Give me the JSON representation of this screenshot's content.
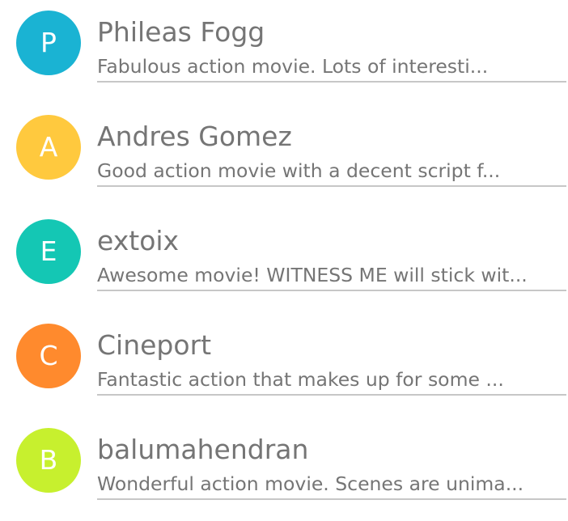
{
  "reviews": [
    {
      "initial": "P",
      "name": "Phileas Fogg",
      "snippet": "Fabulous action movie. Lots of interesti...",
      "color": "#1ab3d3"
    },
    {
      "initial": "A",
      "name": "Andres Gomez",
      "snippet": "Good action movie with a decent script f...",
      "color": "#ffc93e"
    },
    {
      "initial": "E",
      "name": "extoix",
      "snippet": "Awesome movie! WITNESS ME will stick wit...",
      "color": "#14c7b4"
    },
    {
      "initial": "C",
      "name": "Cineport",
      "snippet": "Fantastic action that makes up for some ...",
      "color": "#ff8a2d"
    },
    {
      "initial": "B",
      "name": "balumahendran",
      "snippet": "Wonderful action movie. Scenes are unima...",
      "color": "#c7f02e"
    }
  ]
}
